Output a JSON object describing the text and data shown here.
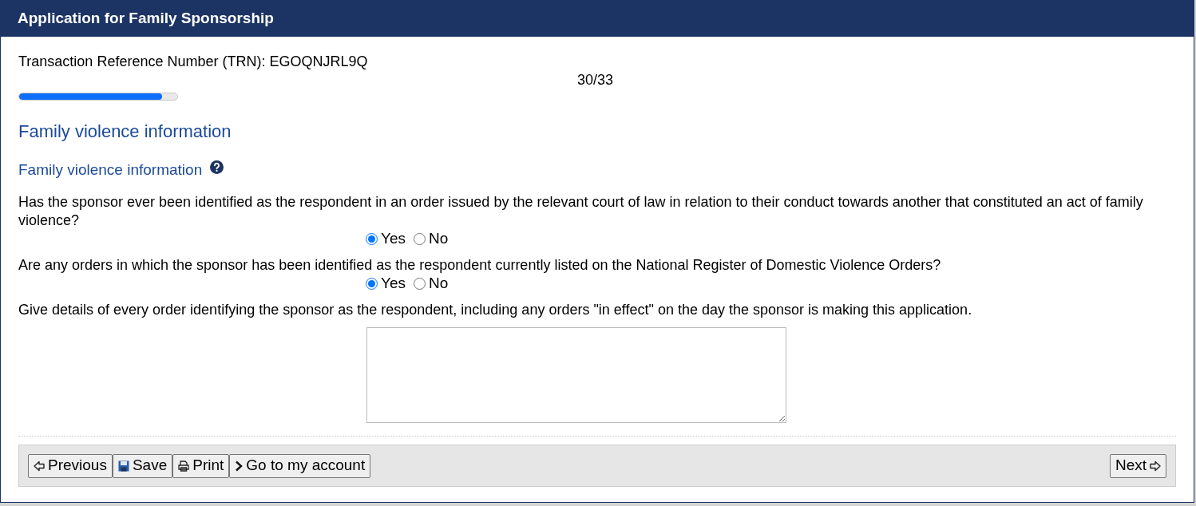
{
  "window": {
    "title": "Application for Family Sponsorship"
  },
  "trn": "Transaction Reference Number (TRN): EGOQNJRL9Q",
  "progress": {
    "reading": "30/33",
    "level": 0.905
  },
  "section_title": "Family violence information",
  "subsection_title": "Family violence information",
  "questions": [
    {
      "kind": "radio",
      "text": "Has the sponsor ever been identified as the respondent in an order issued by the relevant court of law in relation to their conduct towards another that constituted an act of family violence?",
      "options": [
        {
          "label": "Yes",
          "selected": true
        },
        {
          "label": "No",
          "selected": false
        }
      ]
    },
    {
      "kind": "radio",
      "text": "Are any orders in which the sponsor has been identified as the respondent currently listed on the National Register of Domestic Violence Orders?",
      "options": [
        {
          "label": "Yes",
          "selected": true
        },
        {
          "label": "No",
          "selected": false
        }
      ]
    },
    {
      "kind": "textarea",
      "text": "Give details of every order identifying the sponsor as the respondent, including any orders \"in effect\" on the day the sponsor is making this application."
    }
  ],
  "buttons_left": [
    {
      "kind": "previous",
      "label": "Previous"
    },
    {
      "kind": "save",
      "label": "Save"
    },
    {
      "kind": "print",
      "label": "Print"
    },
    {
      "kind": "account",
      "label": "Go to my account"
    }
  ],
  "buttons_right": [
    {
      "kind": "next",
      "label": "Next"
    }
  ]
}
